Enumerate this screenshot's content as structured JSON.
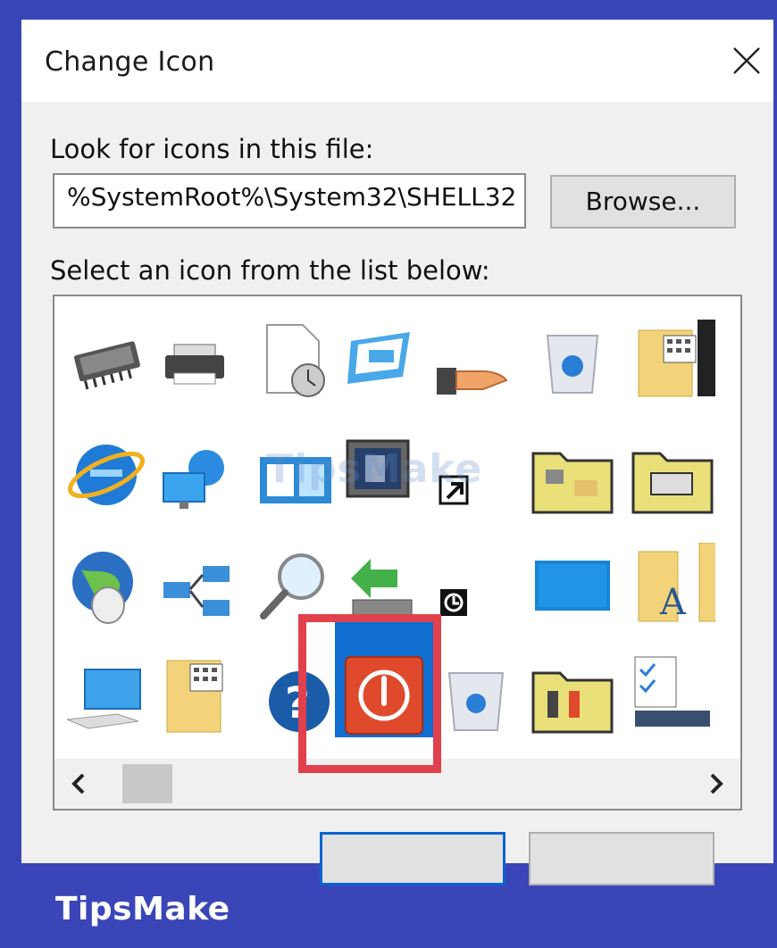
{
  "dialog": {
    "title": "Change Icon",
    "close_icon": "close-icon",
    "look_label": "Look for icons in this file:",
    "file_path": "%SystemRoot%\\System32\\SHELL32",
    "browse_label": "Browse...",
    "select_label": "Select an icon from the list below:",
    "selected_icon": "power-icon",
    "icons": [
      [
        "memory-chip-icon",
        "printer-icon",
        "clock-document-icon",
        "screen-window-icon",
        "hand-share-icon",
        "recycle-bin-full-icon",
        "keypad-folder-icon"
      ],
      [
        "internet-explorer-icon",
        "network-computer-icon",
        "control-panel-icon",
        "media-monitor-icon",
        "shortcut-arrow-icon",
        "network-folder-icon",
        "printer-folder-icon"
      ],
      [
        "globe-mouse-icon",
        "network-connections-icon",
        "search-icon",
        "download-arrow-icon",
        "restore-badge-icon",
        "desktop-blue-icon",
        "fonts-folder-icon"
      ],
      [
        "computer-icon",
        "keypad-folder-icon",
        "help-icon",
        "power-icon",
        "recycle-bin-empty-icon",
        "tools-folder-icon",
        "checklist-icon"
      ]
    ]
  },
  "scroll": {
    "left_icon": "chevron-left-icon",
    "right_icon": "chevron-right-icon"
  },
  "colors": {
    "frame": "#3a46b8",
    "highlight": "#e0414d",
    "selection": "#0f6ed0"
  },
  "watermark": "TipsMake",
  "footer": {
    "brand": "TipsMake"
  }
}
